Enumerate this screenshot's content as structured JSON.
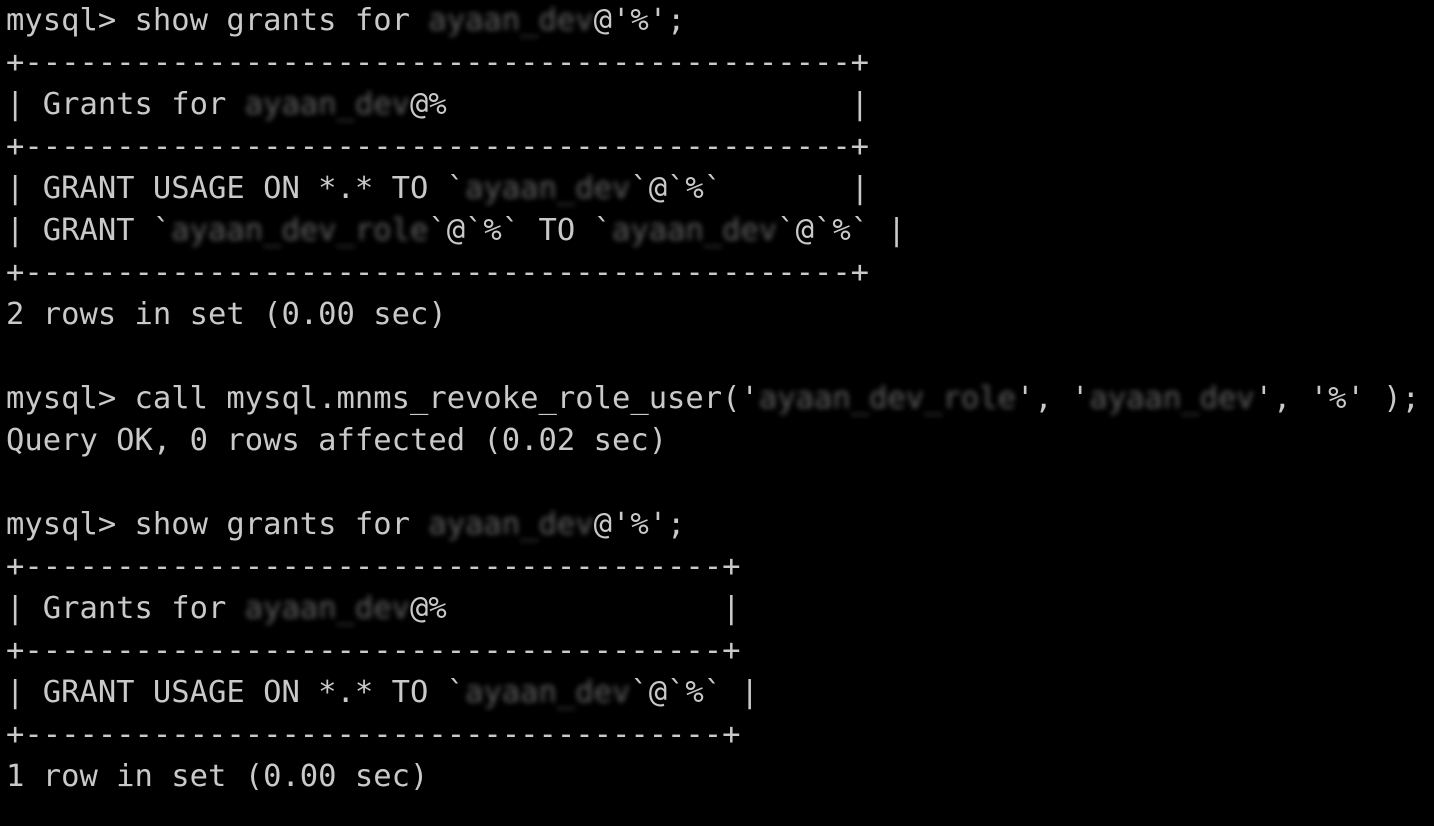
{
  "terminal": {
    "title": "mysql client session",
    "background_color": "#000000",
    "foreground_color": "#c9c9c9",
    "redacted_color": "#6a6a6a",
    "prompt": "mysql> ",
    "lines": [
      {
        "id": "cmd-show-grants-1",
        "kind": "command",
        "text": "mysql> show grants for ayaan_dev@'%';",
        "segments": [
          {
            "text": "mysql> show grants for ",
            "redacted": false
          },
          {
            "text": "ayaan_dev",
            "redacted": true
          },
          {
            "text": "@'%';",
            "redacted": false
          }
        ]
      },
      {
        "id": "table1-border-top",
        "kind": "table-border",
        "text": "+---------------------------------------------+",
        "segments": [
          {
            "text": "+---------------------------------------------+",
            "redacted": false
          }
        ]
      },
      {
        "id": "table1-header",
        "kind": "table-header",
        "text": "| Grants for ayaan_dev@%                      |",
        "segments": [
          {
            "text": "| Grants for ",
            "redacted": false
          },
          {
            "text": "ayaan_dev",
            "redacted": true
          },
          {
            "text": "@%                      |",
            "redacted": false
          }
        ]
      },
      {
        "id": "table1-border-mid",
        "kind": "table-border",
        "text": "+---------------------------------------------+",
        "segments": [
          {
            "text": "+---------------------------------------------+",
            "redacted": false
          }
        ]
      },
      {
        "id": "table1-row-1",
        "kind": "table-row",
        "text": "| GRANT USAGE ON *.* TO `ayaan_dev`@`%`       |",
        "segments": [
          {
            "text": "| GRANT USAGE ON *.* TO `",
            "redacted": false
          },
          {
            "text": "ayaan_dev",
            "redacted": true
          },
          {
            "text": "`@`%`       |",
            "redacted": false
          }
        ]
      },
      {
        "id": "table1-row-2",
        "kind": "table-row",
        "text": "| GRANT `ayaan_dev_role`@`%` TO `ayaan_dev`@`%` |",
        "segments": [
          {
            "text": "| GRANT `",
            "redacted": false
          },
          {
            "text": "ayaan_dev_role",
            "redacted": true
          },
          {
            "text": "`@`%` TO `",
            "redacted": false
          },
          {
            "text": "ayaan_dev",
            "redacted": true
          },
          {
            "text": "`@`%` |",
            "redacted": false
          }
        ]
      },
      {
        "id": "table1-border-bottom",
        "kind": "table-border",
        "text": "+---------------------------------------------+",
        "segments": [
          {
            "text": "+---------------------------------------------+",
            "redacted": false
          }
        ]
      },
      {
        "id": "result-1",
        "kind": "status",
        "text": "2 rows in set (0.00 sec)",
        "segments": [
          {
            "text": "2 rows in set (0.00 sec)",
            "redacted": false
          }
        ]
      },
      {
        "id": "blank-1",
        "kind": "blank",
        "text": "",
        "segments": [
          {
            "text": " ",
            "redacted": false
          }
        ]
      },
      {
        "id": "cmd-call-revoke",
        "kind": "command",
        "text": "mysql> call mysql.mnms_revoke_role_user('ayaan_dev_role', 'ayaan_dev', '%' );",
        "segments": [
          {
            "text": "mysql> call mysql.mnms_revoke_role_user('",
            "redacted": false
          },
          {
            "text": "ayaan_dev_role",
            "redacted": true
          },
          {
            "text": "', '",
            "redacted": false
          },
          {
            "text": "ayaan_dev",
            "redacted": true
          },
          {
            "text": "', '%' );",
            "redacted": false
          }
        ]
      },
      {
        "id": "result-call",
        "kind": "status",
        "text": "Query OK, 0 rows affected (0.02 sec)",
        "segments": [
          {
            "text": "Query OK, 0 rows affected (0.02 sec)",
            "redacted": false
          }
        ]
      },
      {
        "id": "blank-2",
        "kind": "blank",
        "text": "",
        "segments": [
          {
            "text": " ",
            "redacted": false
          }
        ]
      },
      {
        "id": "cmd-show-grants-2",
        "kind": "command",
        "text": "mysql> show grants for ayaan_dev@'%';",
        "segments": [
          {
            "text": "mysql> show grants for ",
            "redacted": false
          },
          {
            "text": "ayaan_dev",
            "redacted": true
          },
          {
            "text": "@'%';",
            "redacted": false
          }
        ]
      },
      {
        "id": "table2-border-top",
        "kind": "table-border",
        "text": "+--------------------------------------+",
        "segments": [
          {
            "text": "+--------------------------------------+",
            "redacted": false
          }
        ]
      },
      {
        "id": "table2-header",
        "kind": "table-header",
        "text": "| Grants for ayaan_dev@%               |",
        "segments": [
          {
            "text": "| Grants for ",
            "redacted": false
          },
          {
            "text": "ayaan_dev",
            "redacted": true
          },
          {
            "text": "@%               |",
            "redacted": false
          }
        ]
      },
      {
        "id": "table2-border-mid",
        "kind": "table-border",
        "text": "+--------------------------------------+",
        "segments": [
          {
            "text": "+--------------------------------------+",
            "redacted": false
          }
        ]
      },
      {
        "id": "table2-row-1",
        "kind": "table-row",
        "text": "| GRANT USAGE ON *.* TO `ayaan_dev`@`%` |",
        "segments": [
          {
            "text": "| GRANT USAGE ON *.* TO `",
            "redacted": false
          },
          {
            "text": "ayaan_dev",
            "redacted": true
          },
          {
            "text": "`@`%` |",
            "redacted": false
          }
        ]
      },
      {
        "id": "table2-border-bottom",
        "kind": "table-border",
        "text": "+--------------------------------------+",
        "segments": [
          {
            "text": "+--------------------------------------+",
            "redacted": false
          }
        ]
      },
      {
        "id": "result-2",
        "kind": "status",
        "text": "1 row in set (0.00 sec)",
        "segments": [
          {
            "text": "1 row in set (0.00 sec)",
            "redacted": false
          }
        ]
      }
    ]
  }
}
